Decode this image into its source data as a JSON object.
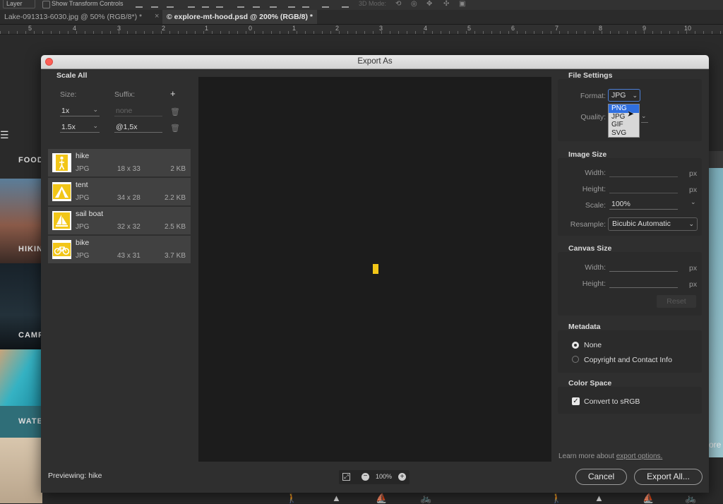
{
  "options_bar": {
    "layer_select": "Layer",
    "show_transform_controls": "Show Transform Controls",
    "mode_3d": "3D Mode:"
  },
  "document_tabs": [
    {
      "label": "Lake-091313-6030.jpg @ 50% (RGB/8*) *"
    },
    {
      "label": "explore-mt-hood.psd @ 200% (RGB/8) *"
    }
  ],
  "ruler": {
    "ticks": [
      "5",
      "4",
      "3",
      "2",
      "1",
      "0",
      "1",
      "2",
      "3",
      "4",
      "5",
      "6",
      "7",
      "8",
      "9",
      "10"
    ]
  },
  "background_site": {
    "nav_food": "FOOD",
    "hiking": "HIKIN",
    "camp": "CAMP",
    "water": "WATE",
    "right_more": "ore"
  },
  "dialog": {
    "title": "Export As",
    "scale_all": {
      "heading": "Scale All",
      "size_label": "Size:",
      "suffix_label": "Suffix:",
      "add_symbol": "+",
      "rows": [
        {
          "size": "1x",
          "suffix": "none"
        },
        {
          "size": "1.5x",
          "suffix": "@1,5x"
        }
      ]
    },
    "assets": [
      {
        "name": "hike",
        "format": "JPG",
        "dims": "18 x 33",
        "size": "2 KB"
      },
      {
        "name": "tent",
        "format": "JPG",
        "dims": "34 x 28",
        "size": "2.2 KB"
      },
      {
        "name": "sail boat",
        "format": "JPG",
        "dims": "32 x 32",
        "size": "2.5 KB"
      },
      {
        "name": "bike",
        "format": "JPG",
        "dims": "43 x 31",
        "size": "3.7 KB"
      }
    ],
    "previewing_label": "Previewing:",
    "previewing_value": "hike",
    "zoom": "100%",
    "file_settings": {
      "heading": "File Settings",
      "format_label": "Format:",
      "format_value": "JPG",
      "quality_label": "Quality:",
      "format_options": [
        "PNG",
        "JPG",
        "GIF",
        "SVG"
      ],
      "highlighted_option": "PNG"
    },
    "image_size": {
      "heading": "Image Size",
      "width_label": "Width:",
      "height_label": "Height:",
      "scale_label": "Scale:",
      "scale_value": "100%",
      "resample_label": "Resample:",
      "resample_value": "Bicubic Automatic",
      "unit": "px"
    },
    "canvas_size": {
      "heading": "Canvas Size",
      "width_label": "Width:",
      "height_label": "Height:",
      "unit": "px",
      "reset": "Reset"
    },
    "metadata": {
      "heading": "Metadata",
      "options": [
        "None",
        "Copyright and Contact Info"
      ],
      "selected": "None"
    },
    "color_space": {
      "heading": "Color Space",
      "convert_label": "Convert to sRGB",
      "checked": true
    },
    "learn_more_prefix": "Learn more about",
    "learn_more_link": "export options.",
    "cancel": "Cancel",
    "export_all": "Export All..."
  },
  "colors": {
    "accent_yellow": "#f2c618",
    "selection_blue": "#2f6fe0",
    "close_red": "#fc5f57"
  }
}
